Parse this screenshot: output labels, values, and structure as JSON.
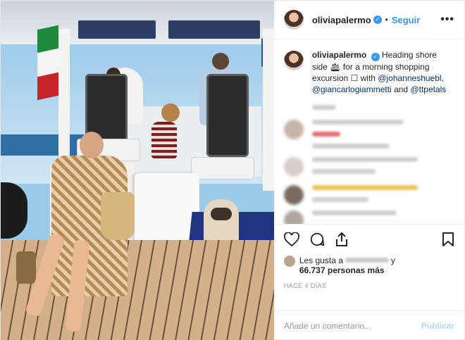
{
  "header": {
    "username": "oliviapalermo",
    "separator": "•",
    "follow_label": "Seguir",
    "more_label": "•••"
  },
  "caption": {
    "username": "oliviapalermo",
    "text_part1": "Heading shore side 🛳 for a morning shopping excursion ☐ with ",
    "mention1": "@johanneshuebl",
    "comma": ",",
    "mention2": "@giancarlogiammetti",
    "and": " and ",
    "mention3": "@ttpetals"
  },
  "likes": {
    "prefix": "Les gusta a",
    "suffix": "y",
    "count": "66.737 personas más"
  },
  "timestamp": "HACE 4 DÍAS",
  "comment_box": {
    "placeholder": "Añade un comentario...",
    "publish_label": "Publicar"
  },
  "colors": {
    "accent": "#3897f0",
    "publish_disabled": "#b3dbff",
    "mention": "#003569"
  },
  "icons": [
    "heart-icon",
    "comment-icon",
    "share-icon",
    "bookmark-icon",
    "verified-icon"
  ]
}
